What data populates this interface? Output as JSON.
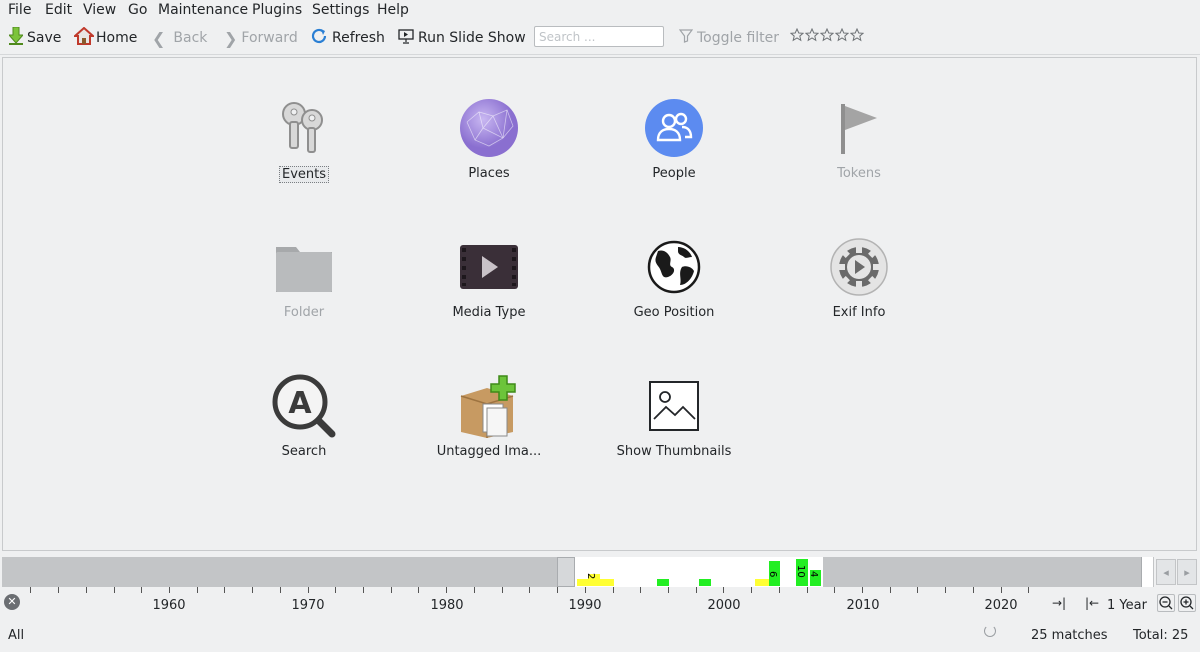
{
  "menubar": {
    "items": [
      {
        "label": "File",
        "key": "F"
      },
      {
        "label": "Edit",
        "key": "E"
      },
      {
        "label": "View",
        "key": "V"
      },
      {
        "label": "Go",
        "key": "G"
      },
      {
        "label": "Maintenance",
        "key": "M"
      },
      {
        "label": "Plugins",
        "key": "P"
      },
      {
        "label": "Settings",
        "key": "S"
      },
      {
        "label": "Help",
        "key": "H"
      }
    ]
  },
  "toolbar": {
    "save_label": "Save",
    "home_label": "Home",
    "back_label": "Back",
    "forward_label": "Forward",
    "refresh_label": "Refresh",
    "slideshow_label": "Run Slide Show",
    "search_placeholder": "Search ...",
    "toggle_filter_label": "Toggle filter",
    "rating_stars": 0
  },
  "categories": [
    {
      "label": "Events",
      "icon": "keys-icon",
      "enabled": true,
      "focused": true
    },
    {
      "label": "Places",
      "icon": "places-network-icon",
      "enabled": true,
      "focused": false
    },
    {
      "label": "People",
      "icon": "people-icon",
      "enabled": true,
      "focused": false
    },
    {
      "label": "Tokens",
      "icon": "flag-icon",
      "enabled": false,
      "focused": false
    },
    {
      "label": "Folder",
      "icon": "folder-icon",
      "enabled": false,
      "focused": false
    },
    {
      "label": "Media Type",
      "icon": "media-play-icon",
      "enabled": true,
      "focused": false
    },
    {
      "label": "Geo Position",
      "icon": "globe-icon",
      "enabled": true,
      "focused": false
    },
    {
      "label": "Exif Info",
      "icon": "camera-gear-icon",
      "enabled": true,
      "focused": false
    },
    {
      "label": "Search",
      "icon": "search-magnifier-icon",
      "enabled": true,
      "focused": false
    },
    {
      "label": "Untagged Ima...",
      "icon": "untagged-box-icon",
      "enabled": true,
      "focused": false
    },
    {
      "label": "Show Thumbnails",
      "icon": "thumbnail-image-icon",
      "enabled": true,
      "focused": false
    }
  ],
  "timeline": {
    "year_labels": [
      "1960",
      "1970",
      "1980",
      "1990",
      "2000",
      "2010",
      "2020"
    ],
    "zoom_label": "1 Year",
    "counts": [
      {
        "year": 1990,
        "count": 2,
        "color": "#ffff33"
      },
      {
        "year": 2004,
        "count": 6,
        "color": "#22ee22"
      },
      {
        "year": 2006,
        "count": 10,
        "color": "#22ee22"
      },
      {
        "year": 2007,
        "count": 4,
        "color": "#22ee22"
      }
    ]
  },
  "status": {
    "filter_label": "All",
    "matches": "25 matches",
    "total": "Total: 25"
  },
  "colors": {
    "background": "#eff0f1",
    "people_blue": "#5c8bf0",
    "places_purple": "#9b84d8",
    "timeline_green": "#22ee22",
    "timeline_yellow": "#ffff33"
  }
}
